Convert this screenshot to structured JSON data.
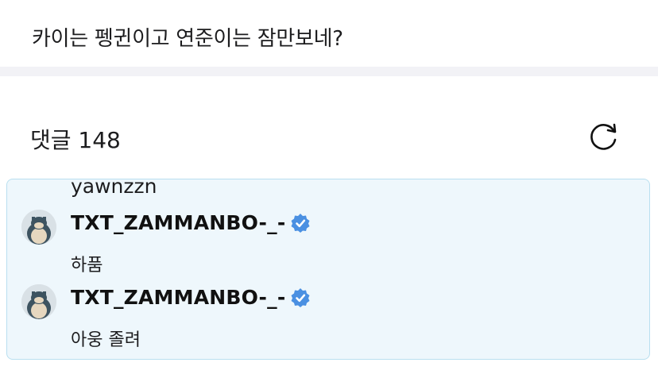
{
  "post": {
    "text": "카이는 펭귄이고 연준이는 잠만보네?"
  },
  "comments_section": {
    "header": "댓글 148",
    "refresh_icon": "refresh-icon"
  },
  "thread": {
    "partial_text": "yawnzzn",
    "comments": [
      {
        "author": "TXT_ZAMMANBO-_-",
        "verified": true,
        "text": "하품",
        "avatar": "snorlax-avatar"
      },
      {
        "author": "TXT_ZAMMANBO-_-",
        "verified": true,
        "text": "아웅 졸려",
        "avatar": "snorlax-avatar"
      }
    ]
  },
  "colors": {
    "highlight_bg": "#eef7fc",
    "highlight_border": "#b9dff0",
    "verified_blue": "#4a90e2"
  }
}
